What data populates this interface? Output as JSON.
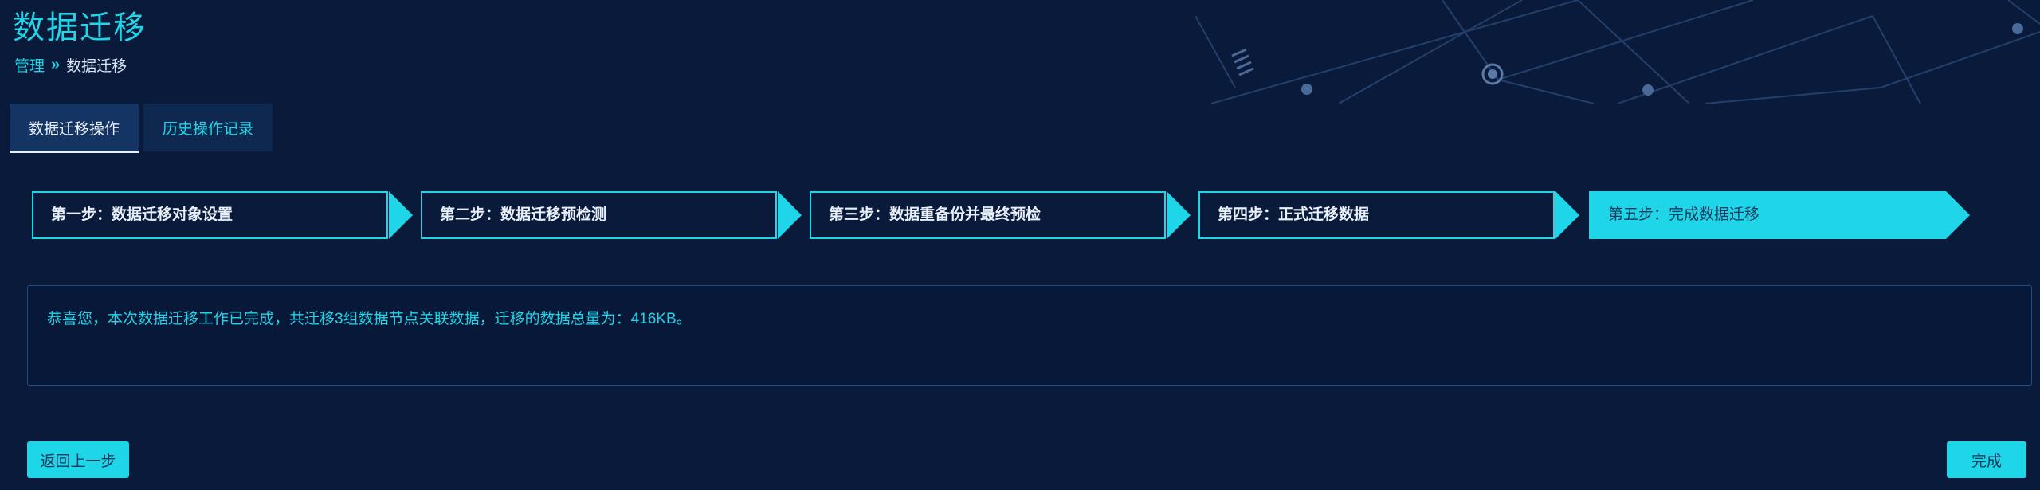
{
  "header": {
    "title": "数据迁移",
    "breadcrumb": {
      "parent": "管理",
      "separator": "»",
      "current": "数据迁移"
    }
  },
  "tabs": [
    {
      "label": "数据迁移操作",
      "active": true
    },
    {
      "label": "历史操作记录",
      "active": false
    }
  ],
  "steps": [
    {
      "label": "第一步：数据迁移对象设置",
      "state": "done"
    },
    {
      "label": "第二步：数据迁移预检测",
      "state": "done"
    },
    {
      "label": "第三步：数据重备份并最终预检",
      "state": "done"
    },
    {
      "label": "第四步：正式迁移数据",
      "state": "done"
    },
    {
      "label": "第五步：完成数据迁移",
      "state": "current"
    }
  ],
  "message": "恭喜您，本次数据迁移工作已完成，共迁移3组数据节点关联数据，迁移的数据总量为：416KB。",
  "buttons": {
    "back": "返回上一步",
    "done": "完成"
  },
  "colors": {
    "background": "#0a1a3a",
    "accent": "#1fd5e8",
    "panel": "#0e2850",
    "border": "#1b4f87"
  }
}
